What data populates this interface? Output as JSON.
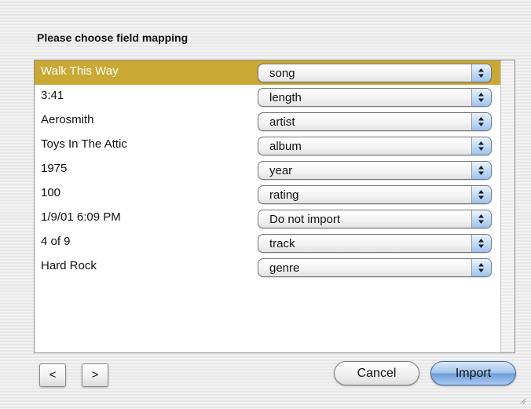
{
  "dialog": {
    "title": "Please choose field mapping"
  },
  "mapping": {
    "rows": [
      {
        "value": "Walk This Way",
        "field": "song",
        "selected": true
      },
      {
        "value": "3:41",
        "field": "length",
        "selected": false
      },
      {
        "value": "Aerosmith",
        "field": "artist",
        "selected": false
      },
      {
        "value": "Toys In The Attic",
        "field": "album",
        "selected": false
      },
      {
        "value": "1975",
        "field": "year",
        "selected": false
      },
      {
        "value": "100",
        "field": "rating",
        "selected": false
      },
      {
        "value": "1/9/01 6:09 PM",
        "field": "Do not import",
        "selected": false
      },
      {
        "value": "4 of 9",
        "field": "track",
        "selected": false
      },
      {
        "value": "Hard Rock",
        "field": "genre",
        "selected": false
      }
    ]
  },
  "navigation": {
    "prev_label": "<",
    "next_label": ">"
  },
  "buttons": {
    "cancel_label": "Cancel",
    "import_label": "Import"
  },
  "colors": {
    "selection": "#c9a933",
    "default_button": "#9fc3ec"
  },
  "icons": {
    "popup_arrows": "up-down-arrows-icon",
    "resize": "resize-grip-icon"
  }
}
